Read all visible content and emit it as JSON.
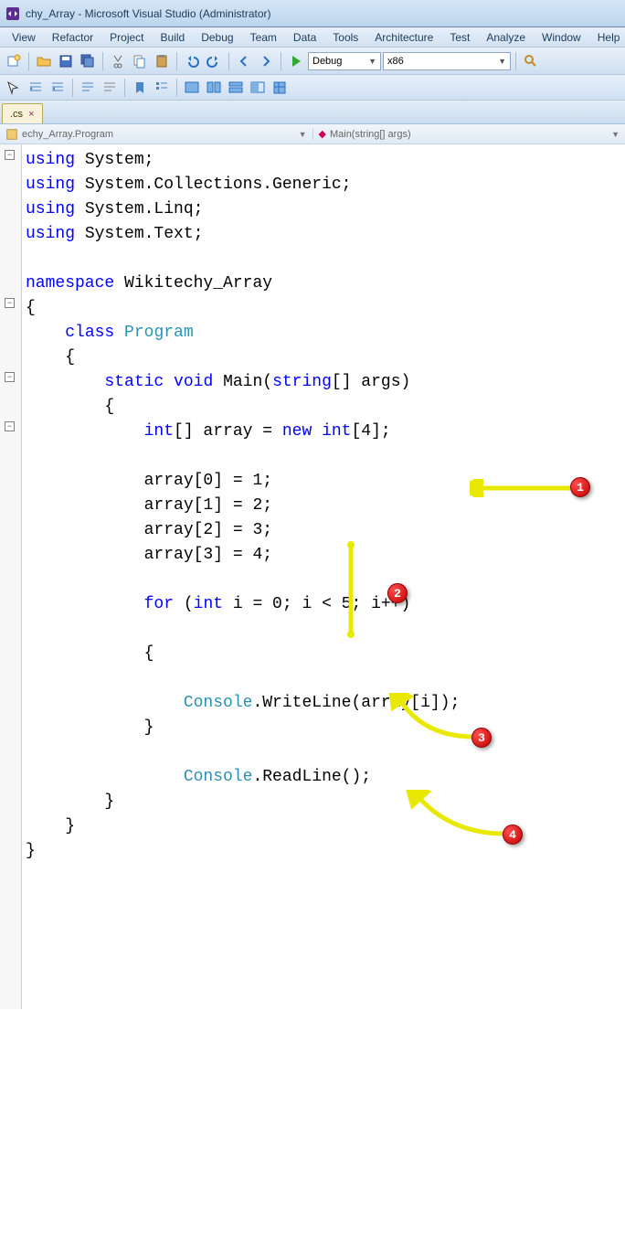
{
  "window": {
    "title": "chy_Array - Microsoft Visual Studio (Administrator)"
  },
  "menu": [
    "View",
    "Refactor",
    "Project",
    "Build",
    "Debug",
    "Team",
    "Data",
    "Tools",
    "Architecture",
    "Test",
    "Analyze",
    "Window",
    "Help"
  ],
  "toolbar": {
    "config": "Debug",
    "platform": "x86"
  },
  "tab": {
    "name": ".cs",
    "close": "×"
  },
  "nav": {
    "left": "echy_Array.Program",
    "right": "Main(string[] args)"
  },
  "code": {
    "l1a": "using",
    "l1b": " System;",
    "l2a": "using",
    "l2b": " System.Collections.Generic;",
    "l3a": "using",
    "l3b": " System.Linq;",
    "l4a": "using",
    "l4b": " System.Text;",
    "l6a": "namespace",
    "l6b": " Wikitechy_Array",
    "l7": "{",
    "l8a": "    ",
    "l8b": "class",
    "l8c": " ",
    "l8d": "Program",
    "l9": "    {",
    "l10a": "        ",
    "l10b": "static",
    "l10c": " ",
    "l10d": "void",
    "l10e": " Main(",
    "l10f": "string",
    "l10g": "[] args)",
    "l11": "        {",
    "l12a": "            ",
    "l12b": "int",
    "l12c": "[] array = ",
    "l12d": "new",
    "l12e": " ",
    "l12f": "int",
    "l12g": "[4];",
    "l14": "            array[0] = 1;",
    "l15": "            array[1] = 2;",
    "l16": "            array[2] = 3;",
    "l17": "            array[3] = 4;",
    "l19a": "            ",
    "l19b": "for",
    "l19c": " (",
    "l19d": "int",
    "l19e": " i = 0; i < 5; i++)",
    "l21": "            {",
    "l23a": "                ",
    "l23b": "Console",
    "l23c": ".WriteLine(array[i]);",
    "l24": "            }",
    "l26a": "                ",
    "l26b": "Console",
    "l26c": ".ReadLine();",
    "l27": "        }",
    "l28": "    }",
    "l29": "}"
  },
  "annotations": {
    "b1": "1",
    "b2": "2",
    "b3": "3",
    "b4": "4"
  }
}
